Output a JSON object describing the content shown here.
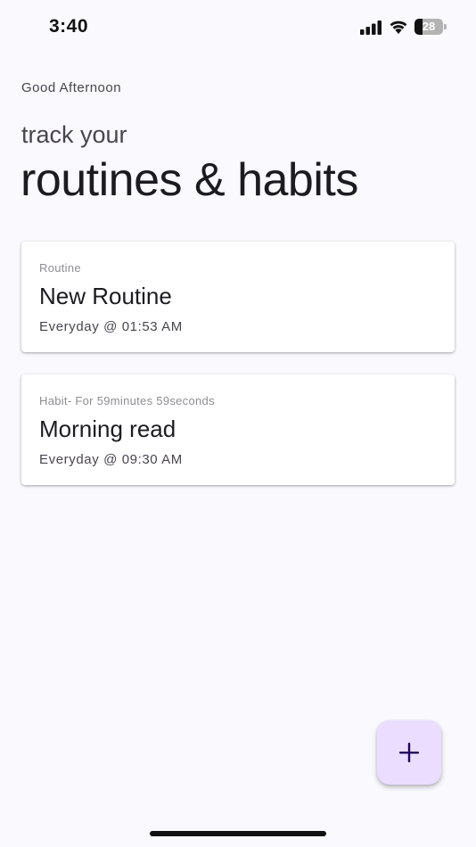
{
  "status_bar": {
    "time": "3:40",
    "battery_level": "28",
    "battery_fraction": 0.28
  },
  "header": {
    "greeting": "Good Afternoon",
    "subtitle": "track your",
    "title": "routines & habits"
  },
  "items": [
    {
      "type_label": "Routine",
      "name": "New Routine",
      "schedule": "Everyday @ 01:53 AM"
    },
    {
      "type_label": "Habit- For 59minutes 59seconds",
      "name": "Morning read",
      "schedule": "Everyday @ 09:30 AM"
    }
  ],
  "fab": {
    "icon": "plus-icon",
    "background": "#eaddff",
    "icon_color": "#21005d"
  },
  "colors": {
    "background": "#f9f9fe",
    "card": "#ffffff",
    "text_primary": "#1c1b1f",
    "text_secondary": "#49454f"
  }
}
